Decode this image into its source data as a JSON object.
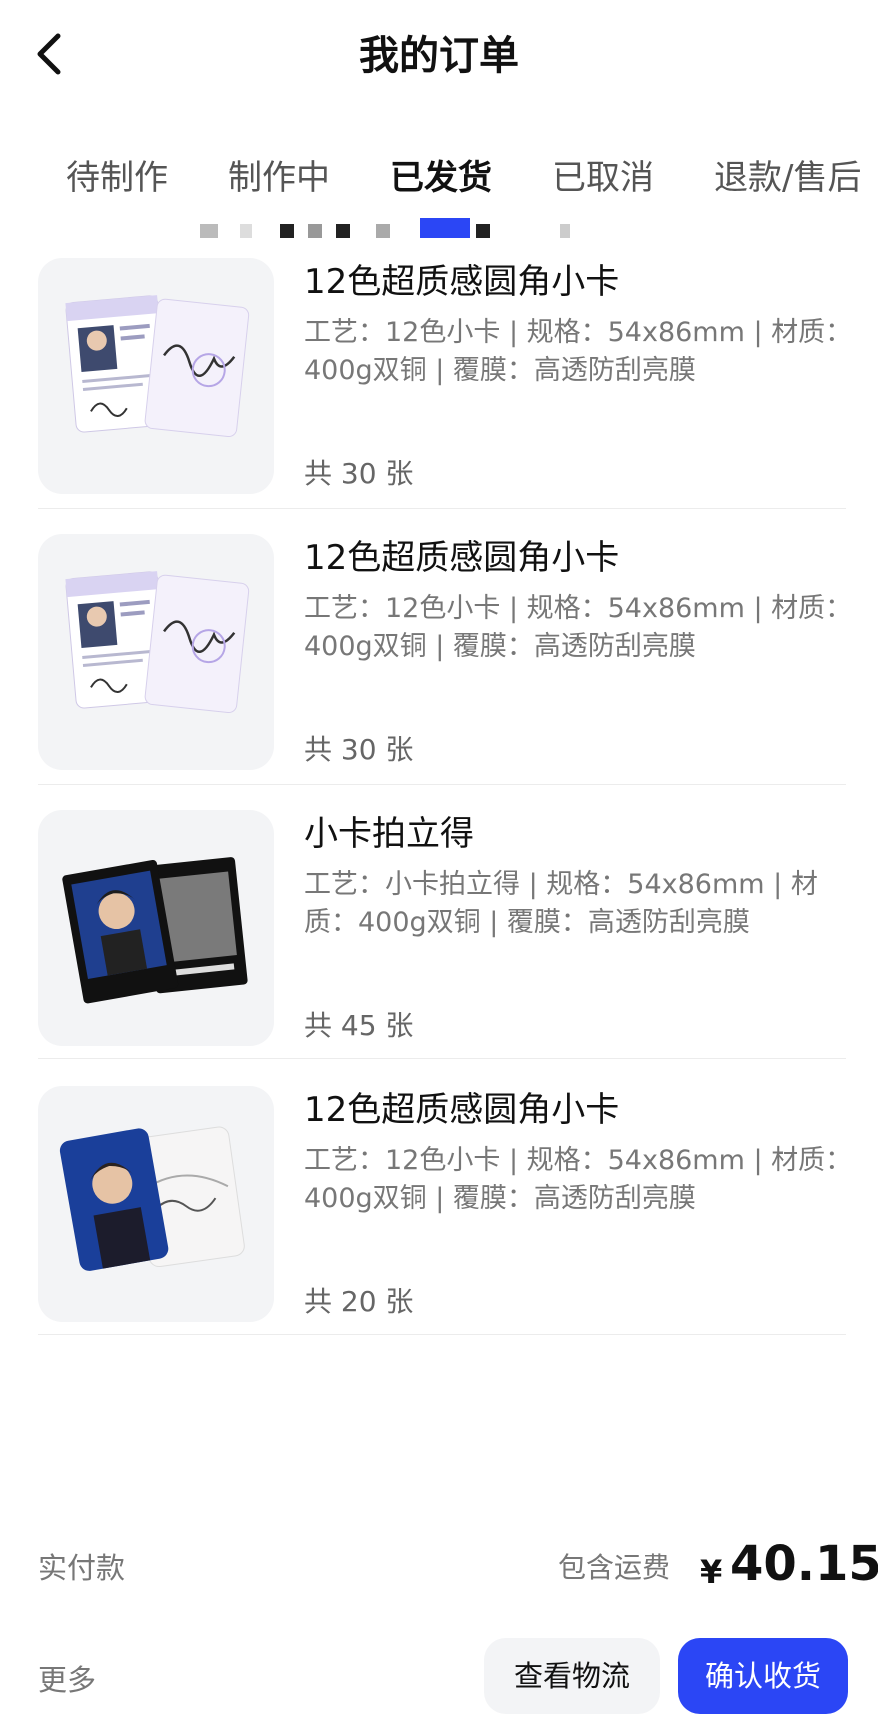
{
  "header": {
    "title": "我的订单"
  },
  "tabs": [
    {
      "label": "待制作",
      "active": false
    },
    {
      "label": "制作中",
      "active": false
    },
    {
      "label": "已发货",
      "active": true
    },
    {
      "label": "已取消",
      "active": false
    },
    {
      "label": "退款/售后",
      "active": false
    }
  ],
  "items": [
    {
      "name": "12色超质感圆角小卡",
      "spec": "工艺：12色小卡 | 规格：54x86mm | 材质：400g双铜 | 覆膜：高透防刮亮膜",
      "qty": "共 30 张",
      "image": "photocard-purple-signature"
    },
    {
      "name": "12色超质感圆角小卡",
      "spec": "工艺：12色小卡 | 规格：54x86mm | 材质：400g双铜 | 覆膜：高透防刮亮膜",
      "qty": "共 30 张",
      "image": "photocard-purple-signature"
    },
    {
      "name": "小卡拍立得",
      "spec": "工艺：小卡拍立得 | 规格：54x86mm | 材质：400g双铜 | 覆膜：高透防刮亮膜",
      "qty": "共 45 张",
      "image": "polaroid-black-card"
    },
    {
      "name": "12色超质感圆角小卡",
      "spec": "工艺：12色小卡 | 规格：54x86mm | 材质：400g双铜 | 覆膜：高透防刮亮膜",
      "qty": "共 20 张",
      "image": "photocard-blue-portrait"
    }
  ],
  "footer": {
    "pay_label": "实付款",
    "shipping_note": "包含运费",
    "currency": "¥",
    "amount": "40.15",
    "more": "更多",
    "logistics_button": "查看物流",
    "confirm_button": "确认收货"
  },
  "colors": {
    "accent": "#2b46f5",
    "muted_text": "#777777",
    "thumb_bg": "#f3f4f6"
  }
}
